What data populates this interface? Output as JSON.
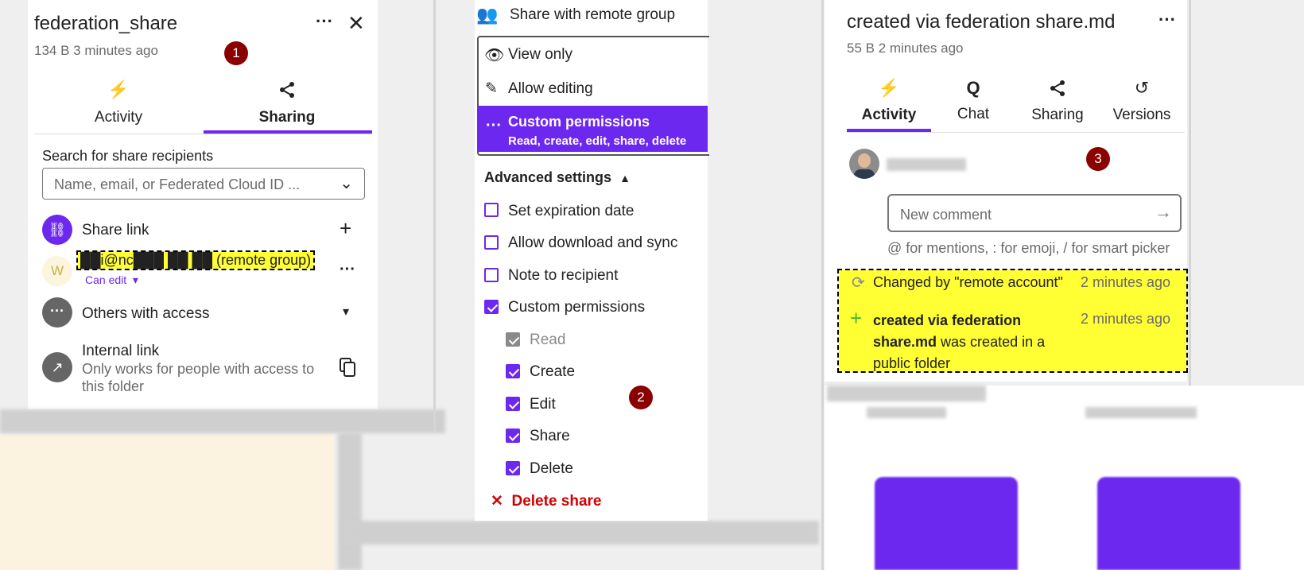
{
  "left": {
    "title": "federation_share",
    "meta": "134 B 3 minutes ago",
    "badge": "1",
    "tabs": [
      {
        "label": "Activity",
        "icon": "lightning-icon"
      },
      {
        "label": "Sharing",
        "icon": "share-icon"
      }
    ],
    "search_label": "Search for share recipients",
    "search_placeholder": "Name, email, or Federated Cloud ID ...",
    "share_link_label": "Share link",
    "recipient": {
      "avatar": "W",
      "name": "██i@nc███ ██ ██ (remote group)",
      "permission": "Can edit"
    },
    "others_label": "Others with access",
    "internal_link_label": "Internal link",
    "internal_link_desc": "Only works for people with access to this folder"
  },
  "middle": {
    "header": "Share with remote group",
    "permission_options": [
      {
        "label": "View only",
        "icon": "eye-icon"
      },
      {
        "label": "Allow editing",
        "icon": "pencil-icon"
      }
    ],
    "custom_title": "Custom permissions",
    "custom_desc": "Read, create, edit, share, delete",
    "advanced_label": "Advanced settings",
    "checkboxes": [
      {
        "label": "Set expiration date",
        "checked": false
      },
      {
        "label": "Allow download and sync",
        "checked": false
      },
      {
        "label": "Note to recipient",
        "checked": false
      },
      {
        "label": "Custom permissions",
        "checked": true
      }
    ],
    "sub_checkboxes": [
      {
        "label": "Read",
        "checked": true,
        "disabled": true
      },
      {
        "label": "Create",
        "checked": true
      },
      {
        "label": "Edit",
        "checked": true
      },
      {
        "label": "Share",
        "checked": true
      },
      {
        "label": "Delete",
        "checked": true
      }
    ],
    "delete_label": "Delete share",
    "badge": "2"
  },
  "right": {
    "title": "created via federation share.md",
    "meta": "55 B 2 minutes ago",
    "tabs": [
      {
        "label": "Activity",
        "icon": "lightning-icon"
      },
      {
        "label": "Chat",
        "icon": "chat-icon"
      },
      {
        "label": "Sharing",
        "icon": "share-icon"
      },
      {
        "label": "Versions",
        "icon": "history-icon"
      }
    ],
    "badge": "3",
    "comment_placeholder": "New comment",
    "comment_hint": "@ for mentions, : for emoji, / for smart picker",
    "activities": [
      {
        "text": "Changed by \"remote account\"",
        "time": "2 minutes ago"
      },
      {
        "bold": "created via federation share.md",
        "rest": " was created in a public folder",
        "time": "2 minutes ago"
      }
    ]
  },
  "colors": {
    "accent": "#6d28f0",
    "highlight": "#ffff33",
    "badge": "#8b0000",
    "danger": "#d10000"
  }
}
